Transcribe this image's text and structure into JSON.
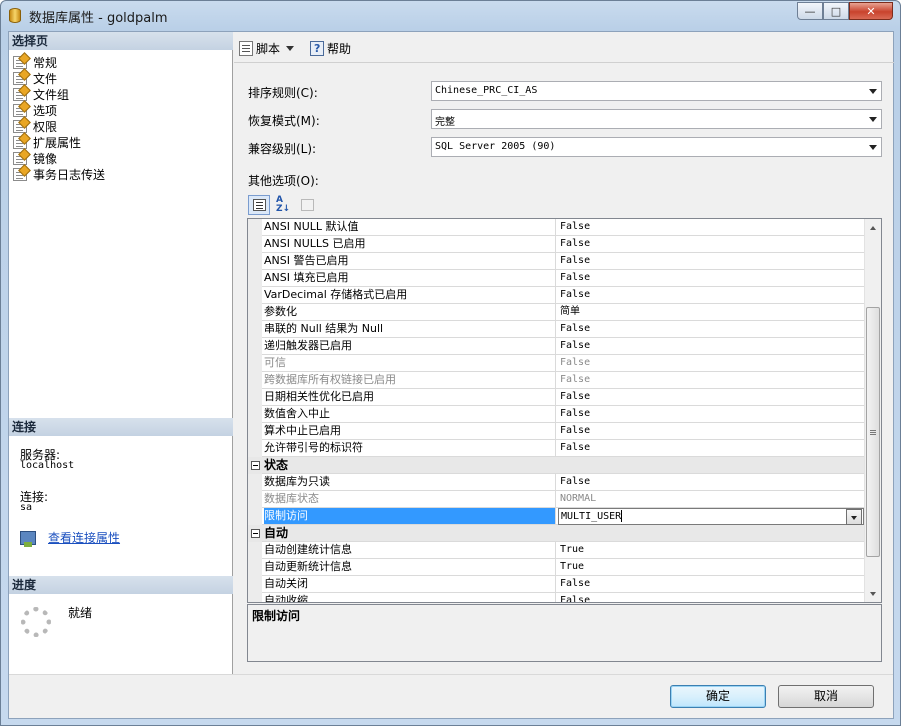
{
  "window": {
    "title": "数据库属性 - goldpalm",
    "minimize_glyph": "—",
    "maximize_glyph": "□",
    "close_glyph": "✕"
  },
  "left": {
    "select_page_header": "选择页",
    "pages": [
      {
        "label": "常规"
      },
      {
        "label": "文件"
      },
      {
        "label": "文件组"
      },
      {
        "label": "选项"
      },
      {
        "label": "权限"
      },
      {
        "label": "扩展属性"
      },
      {
        "label": "镜像"
      },
      {
        "label": "事务日志传送"
      }
    ],
    "connection_header": "连接",
    "server_label": "服务器:",
    "server_value": "localhost",
    "connection_label": "连接:",
    "connection_value": "sa",
    "view_conn_props_link": "查看连接属性",
    "progress_header": "进度",
    "progress_status": "就绪"
  },
  "toolbar": {
    "script_label": "脚本",
    "help_label": "帮助"
  },
  "fields": {
    "collation_label": "排序规则(C):",
    "collation_value": "Chinese_PRC_CI_AS",
    "recovery_label": "恢复模式(M):",
    "recovery_value": "完整",
    "compat_label": "兼容级别(L):",
    "compat_value": "SQL Server 2005 (90)",
    "other_options_label": "其他选项(O):"
  },
  "grid": {
    "rows": [
      {
        "type": "prop",
        "name": "ANSI NULL 默认值",
        "value": "False",
        "state": "normal"
      },
      {
        "type": "prop",
        "name": "ANSI NULLS 已启用",
        "value": "False",
        "state": "normal"
      },
      {
        "type": "prop",
        "name": "ANSI 警告已启用",
        "value": "False",
        "state": "normal"
      },
      {
        "type": "prop",
        "name": "ANSI 填充已启用",
        "value": "False",
        "state": "normal"
      },
      {
        "type": "prop",
        "name": "VarDecimal 存储格式已启用",
        "value": "False",
        "state": "normal"
      },
      {
        "type": "prop",
        "name": "参数化",
        "value": "简单",
        "state": "normal"
      },
      {
        "type": "prop",
        "name": "串联的 Null 结果为 Null",
        "value": "False",
        "state": "normal"
      },
      {
        "type": "prop",
        "name": "递归触发器已启用",
        "value": "False",
        "state": "normal"
      },
      {
        "type": "prop",
        "name": "可信",
        "value": "False",
        "state": "disabled"
      },
      {
        "type": "prop",
        "name": "跨数据库所有权链接已启用",
        "value": "False",
        "state": "disabled"
      },
      {
        "type": "prop",
        "name": "日期相关性优化已启用",
        "value": "False",
        "state": "normal"
      },
      {
        "type": "prop",
        "name": "数值舍入中止",
        "value": "False",
        "state": "normal"
      },
      {
        "type": "prop",
        "name": "算术中止已启用",
        "value": "False",
        "state": "normal"
      },
      {
        "type": "prop",
        "name": "允许带引号的标识符",
        "value": "False",
        "state": "normal"
      },
      {
        "type": "cat",
        "name": "状态"
      },
      {
        "type": "prop",
        "name": "数据库为只读",
        "value": "False",
        "state": "normal"
      },
      {
        "type": "prop",
        "name": "数据库状态",
        "value": "NORMAL",
        "state": "disabled"
      },
      {
        "type": "prop",
        "name": "限制访问",
        "value": "MULTI_USER",
        "state": "selected"
      },
      {
        "type": "cat",
        "name": "自动"
      },
      {
        "type": "prop",
        "name": "自动创建统计信息",
        "value": "True",
        "state": "normal"
      },
      {
        "type": "prop",
        "name": "自动更新统计信息",
        "value": "True",
        "state": "normal"
      },
      {
        "type": "prop",
        "name": "自动关闭",
        "value": "False",
        "state": "normal"
      },
      {
        "type": "prop",
        "name": "自动收缩",
        "value": "False",
        "state": "normal"
      }
    ]
  },
  "description": {
    "title": "限制访问"
  },
  "buttons": {
    "ok": "确定",
    "cancel": "取消"
  }
}
